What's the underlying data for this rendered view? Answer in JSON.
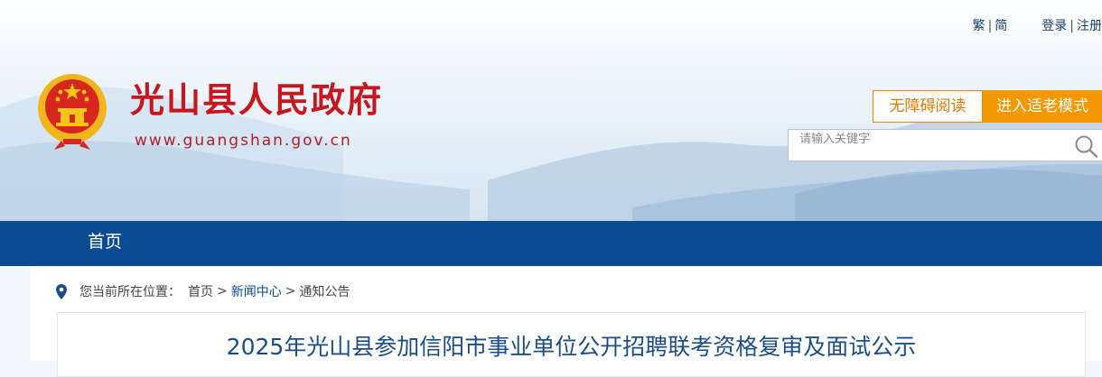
{
  "header": {
    "lang_traditional": "繁",
    "lang_simplified": "简",
    "login": "登录",
    "register": "注册",
    "site_title": "光山县人民政府",
    "site_url": "www.guangshan.gov.cn",
    "accessibility_button": "无障碍阅读",
    "elderly_mode_button": "进入适老模式",
    "search_placeholder": "请输入关键字"
  },
  "nav": {
    "items": [
      {
        "label": "首页"
      }
    ]
  },
  "breadcrumb": {
    "prefix": "您当前所在位置：",
    "items": [
      "首页",
      "新闻中心",
      "通知公告"
    ],
    "separator": ">"
  },
  "article": {
    "title": "2025年光山县参加信阳市事业单位公开招聘联考资格复审及面试公示"
  },
  "colors": {
    "nav_bg": "#0a4b93",
    "title_red": "#c8161d",
    "accent_orange": "#f39800"
  }
}
